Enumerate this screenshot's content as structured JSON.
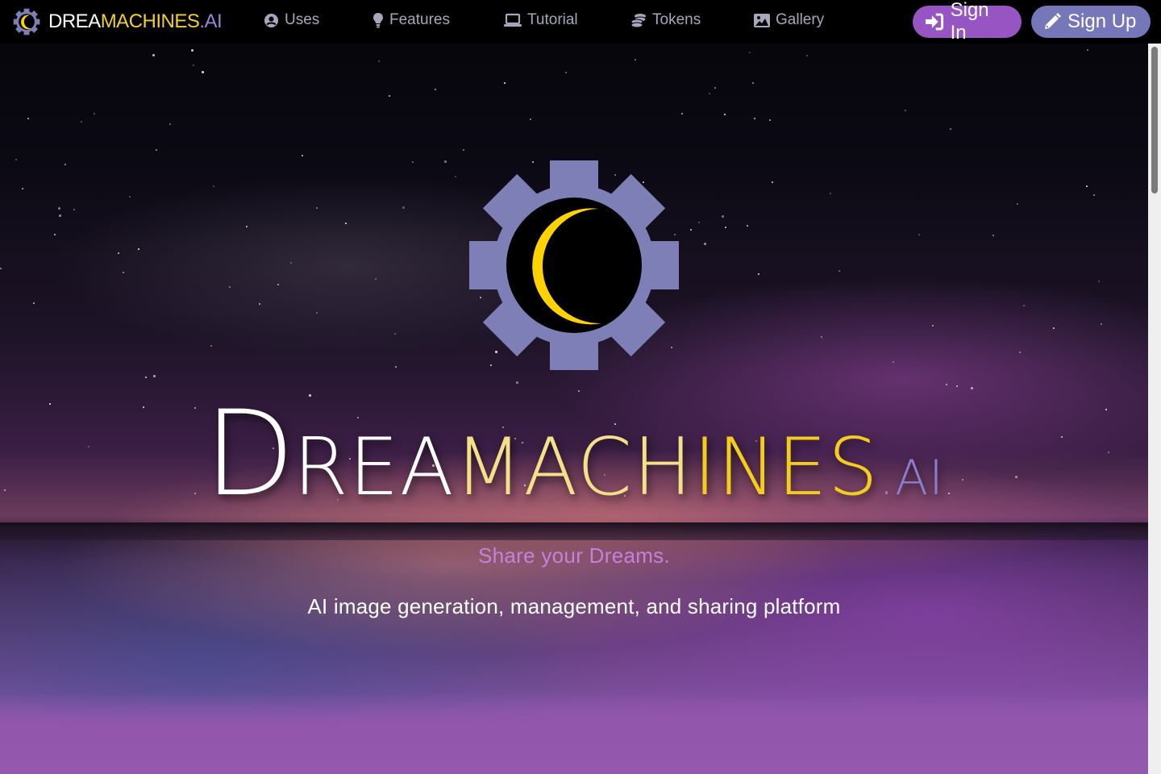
{
  "brand": {
    "name_part1": "DREA",
    "name_part2": "MACHINES",
    "name_part3": ".AI",
    "logo_icon": "gear-moon-logo"
  },
  "nav": {
    "links": [
      {
        "label": "Uses",
        "icon": "user-circle-icon"
      },
      {
        "label": "Features",
        "icon": "lightbulb-icon"
      },
      {
        "label": "Tutorial",
        "icon": "laptop-icon"
      },
      {
        "label": "Tokens",
        "icon": "coins-icon"
      },
      {
        "label": "Gallery",
        "icon": "image-icon"
      }
    ],
    "sign_in": {
      "label": "Sign In",
      "icon": "sign-in-icon"
    },
    "sign_up": {
      "label": "Sign Up",
      "icon": "pencil-icon"
    }
  },
  "hero": {
    "title_initial": "D",
    "title_white": "REA",
    "title_light_yellow": "MACH",
    "title_yellow": "INES",
    "title_suffix": ".AI",
    "tagline": "Share your Dreams.",
    "subtitle": "AI image generation, management, and sharing platform"
  },
  "colors": {
    "nav_bg": "#000000",
    "nav_link": "#a6a6bd",
    "brand_yellow": "#f2cf2e",
    "brand_purple": "#9b85d8",
    "sign_in_bg": "#9655c3",
    "sign_up_bg": "#7677b8",
    "gear": "#7f7fb7",
    "moon": "#ffd200",
    "tagline": "#c87fd9"
  }
}
